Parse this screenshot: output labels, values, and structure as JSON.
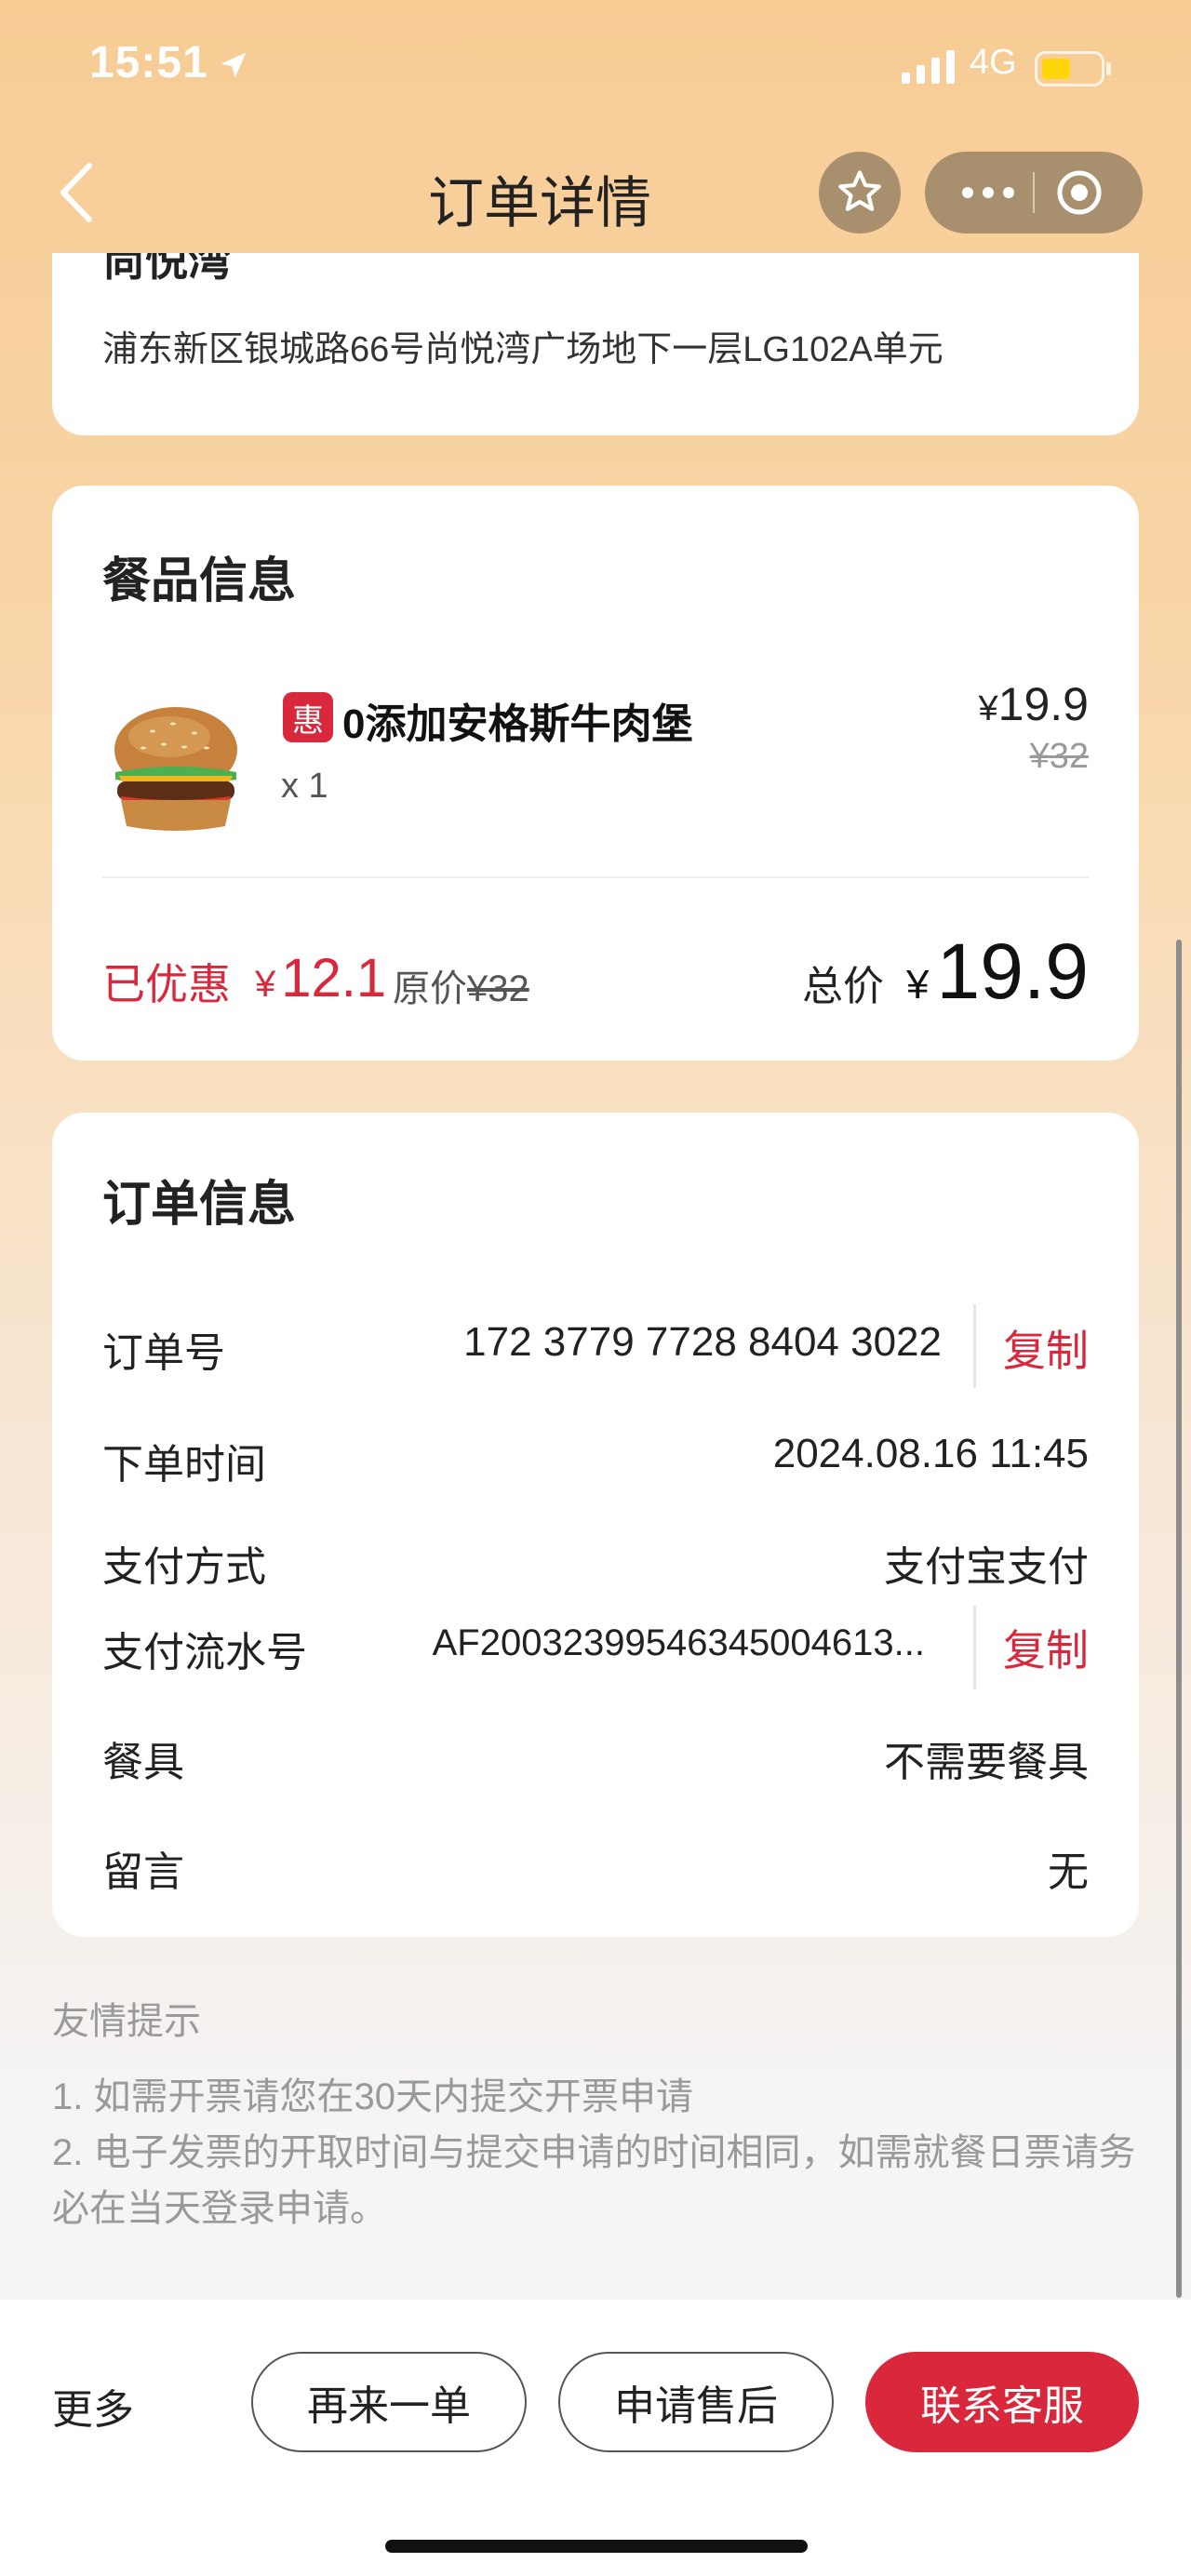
{
  "status_bar": {
    "time": "15:51",
    "network": "4G"
  },
  "nav": {
    "title": "订单详情"
  },
  "address": {
    "name": "尚悦湾",
    "line": "浦东新区银城路66号尚悦湾广场地下一层LG102A单元"
  },
  "food": {
    "section_title": "餐品信息",
    "item": {
      "badge": "惠",
      "name": "0添加安格斯牛肉堡",
      "qty": "x 1",
      "currency": "¥",
      "price": "19.9",
      "orig_price": "¥32"
    },
    "discount_label": "已优惠",
    "discount_currency": "¥",
    "discount_amount": "12.1",
    "orig_label": "原价",
    "orig_amount": "¥32",
    "total_label": "总价",
    "total_currency": "¥",
    "total_amount": "19.9"
  },
  "order": {
    "section_title": "订单信息",
    "rows": [
      {
        "label": "订单号",
        "value": "172 3779 7728 8404 3022",
        "action": "复制"
      },
      {
        "label": "下单时间",
        "value": "2024.08.16 11:45"
      },
      {
        "label": "支付方式",
        "value": "支付宝支付"
      },
      {
        "label": "支付流水号",
        "value": "AF20032399546345004613...",
        "action": "复制"
      },
      {
        "label": "餐具",
        "value": "不需要餐具"
      },
      {
        "label": "留言",
        "value": "无"
      }
    ]
  },
  "tips": {
    "title": "友情提示",
    "items": [
      "1. 如需开票请您在30天内提交开票申请",
      "2. 电子发票的开取时间与提交申请的时间相同，如需就餐日票请务必在当天登录申请。"
    ]
  },
  "bottom": {
    "more": "更多",
    "reorder": "再来一单",
    "after_sale": "申请售后",
    "contact": "联系客服"
  },
  "colors": {
    "accent_red": "#d9283b",
    "capsule": "#a8906e"
  },
  "icons": [
    "back-chevron-icon",
    "star-icon",
    "more-dots-icon",
    "target-icon",
    "location-arrow-icon",
    "signal-icon",
    "battery-icon"
  ]
}
